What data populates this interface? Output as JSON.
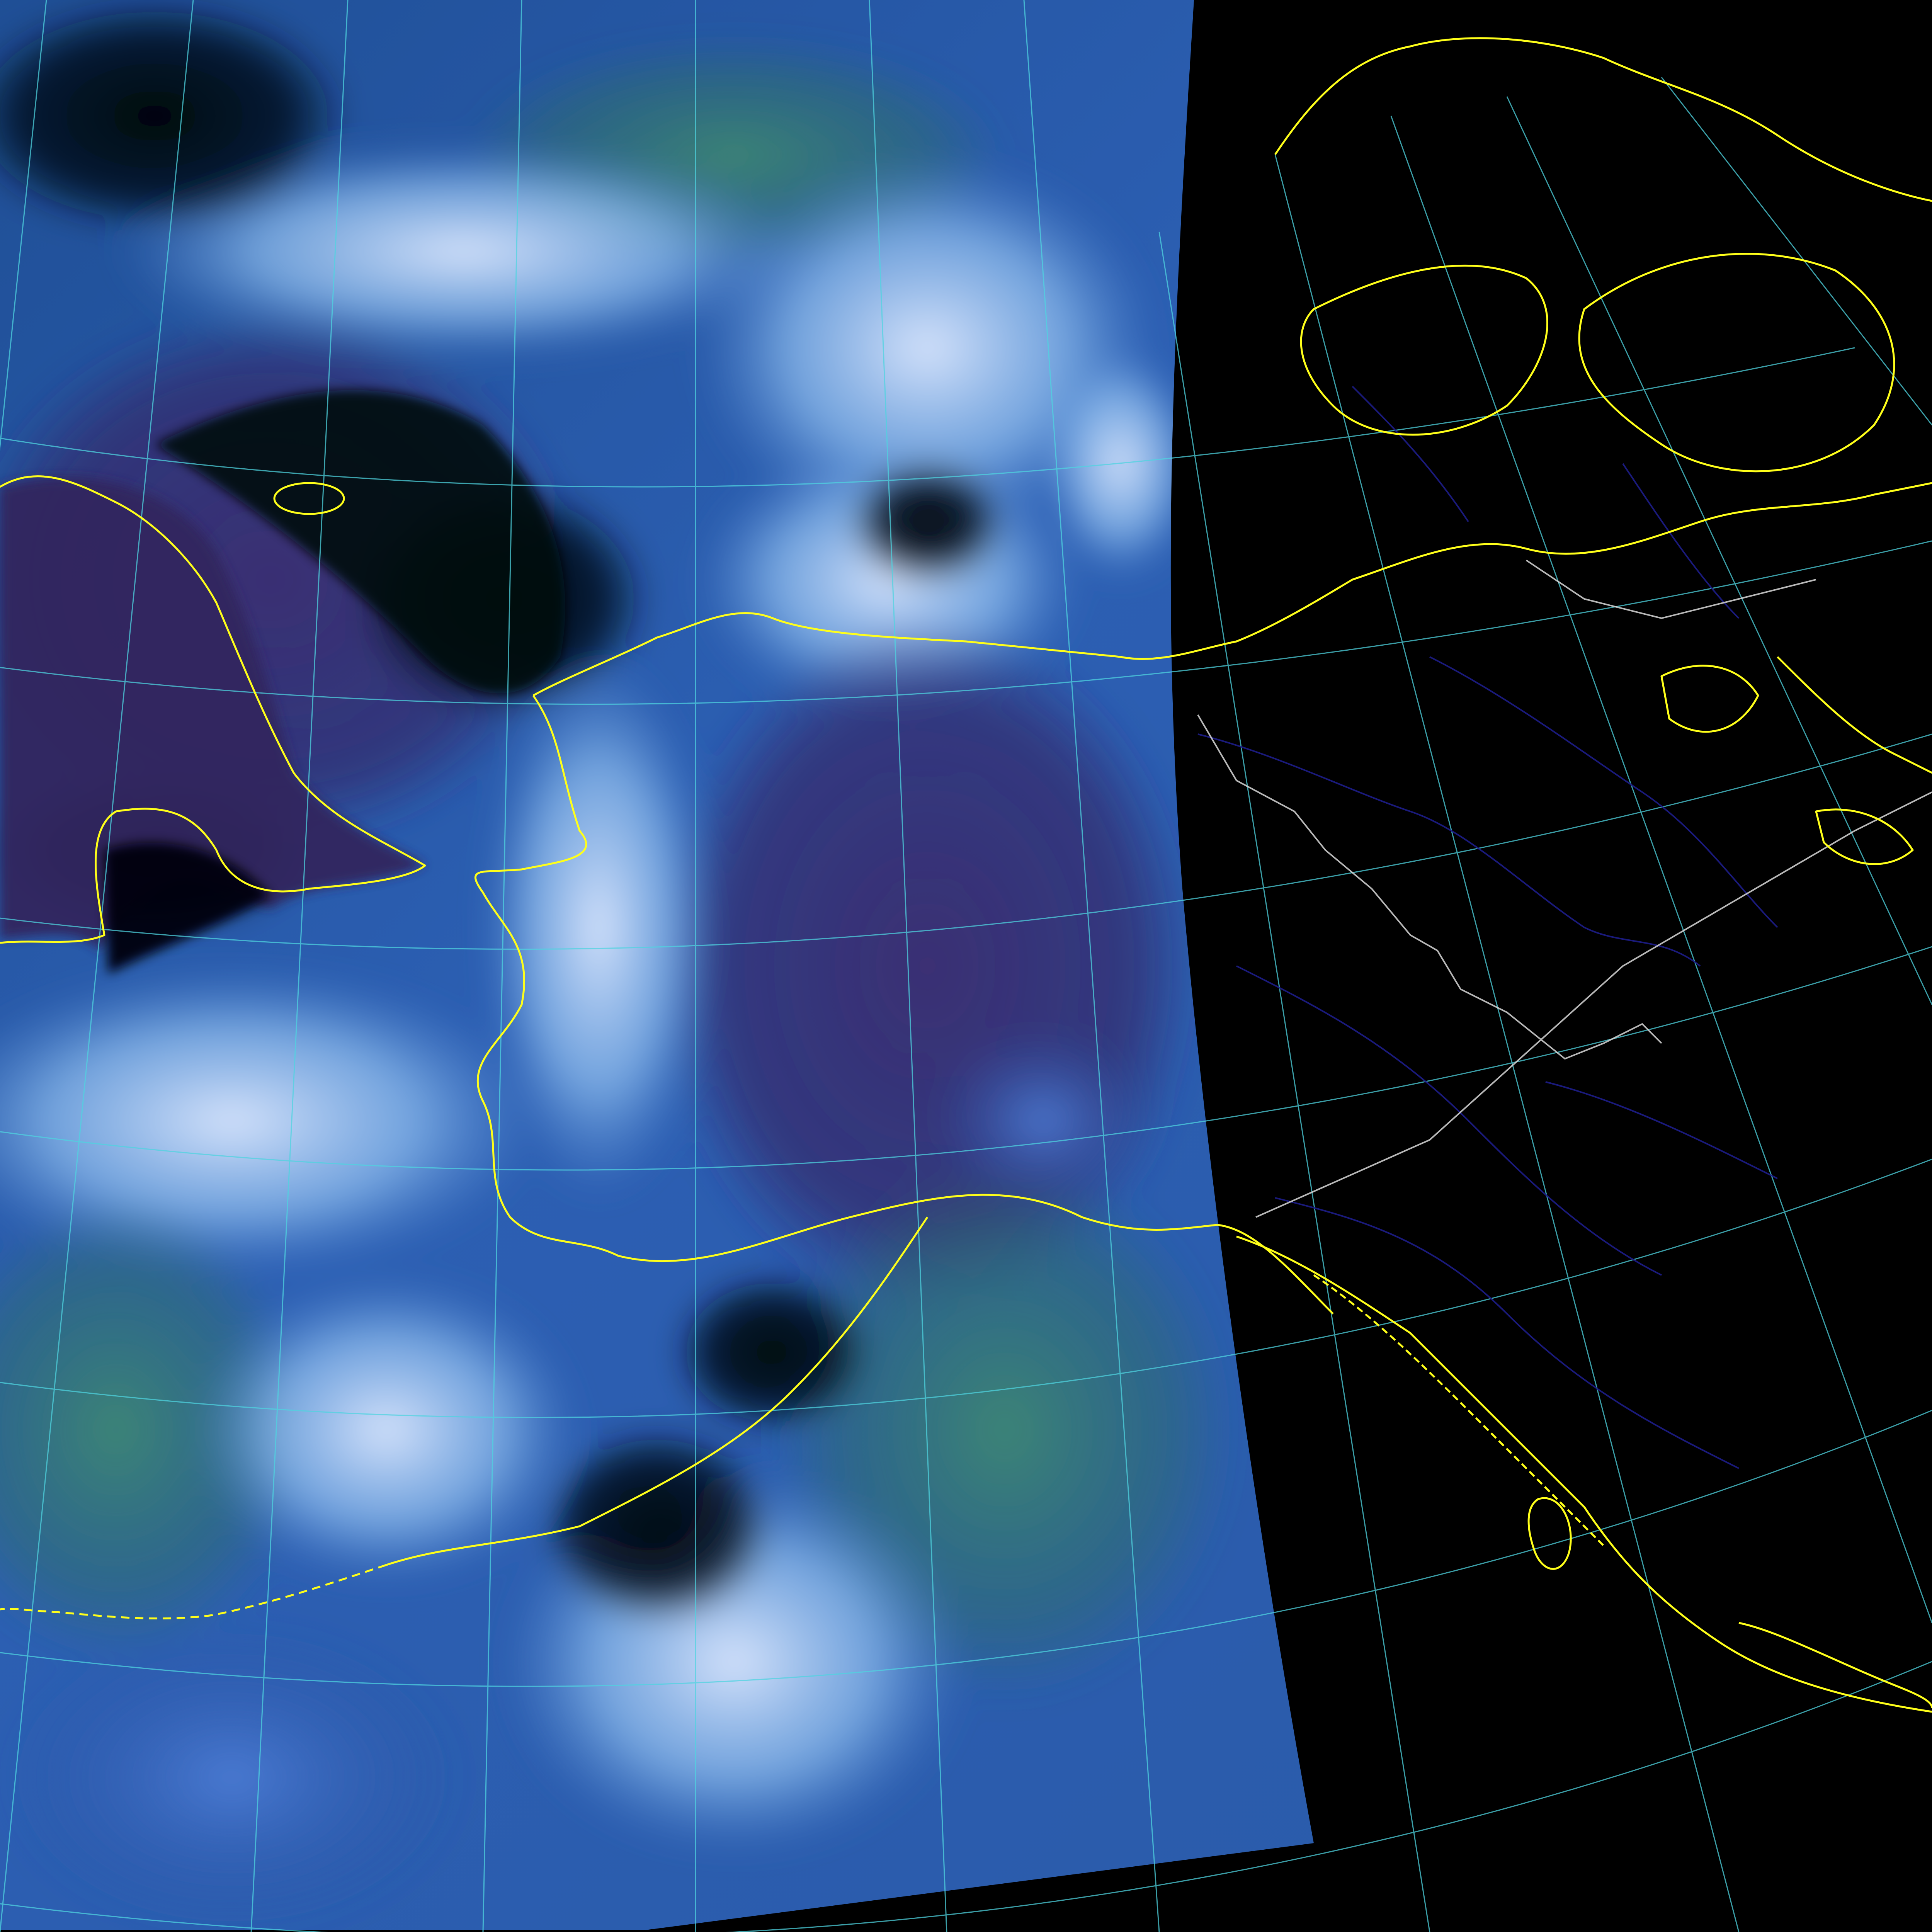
{
  "map": {
    "kind": "satellite false-color composite over polar-stereographic projection",
    "colors": {
      "background": "#000000",
      "graticule": "#4fd4e0",
      "coastline": "#ffff1a",
      "border": "#d8d8d8",
      "rivers": "#1d1d8a",
      "cloud_light": "#8fc4f0",
      "cloud_white": "#d6e6ff",
      "cloud_teal": "#2f7a66",
      "land_purple": "#3a2a66",
      "ocean_dark": "#02060d"
    },
    "swath": {
      "label": "",
      "description_note": ""
    },
    "layers": [
      "satellite-swath",
      "graticule",
      "rivers",
      "borders",
      "coastlines"
    ]
  }
}
